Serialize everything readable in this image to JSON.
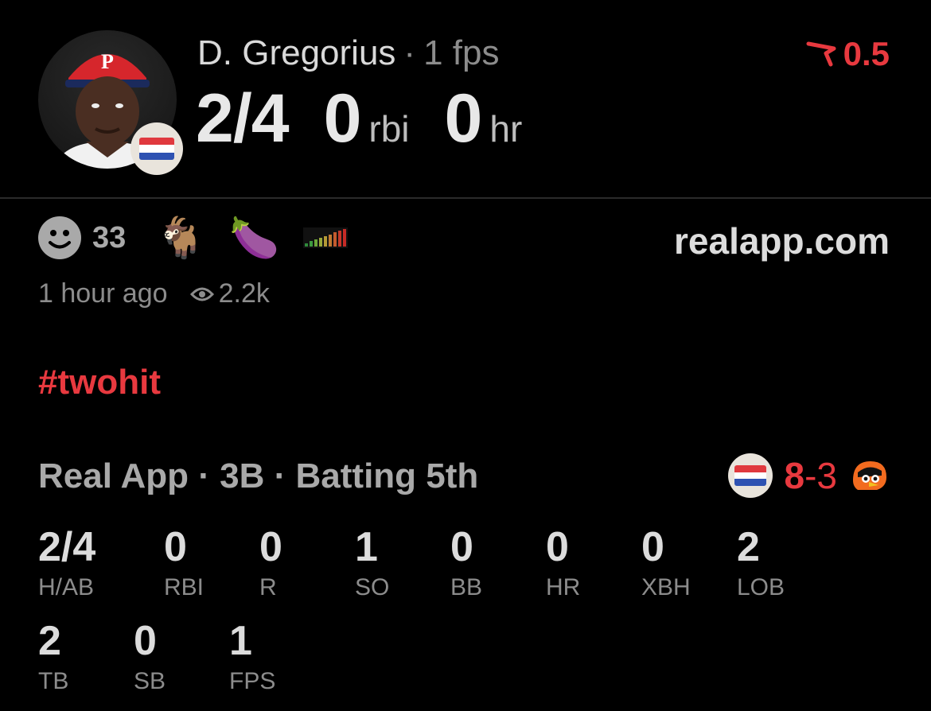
{
  "player": {
    "name": "D. Gregorius",
    "separator": "·",
    "fps": "1 fps",
    "hits_ab": "2/4",
    "rbi_value": "0",
    "rbi_unit": "rbi",
    "hr_value": "0",
    "hr_unit": "hr",
    "avatar_icon": "player-photo",
    "flag_icon": "netherlands-flag"
  },
  "rating": {
    "icon": "real-logo-icon",
    "value": "0.5",
    "color": "#e8393f"
  },
  "reactions": {
    "count": "33",
    "icons": [
      "smiley-icon",
      "goat-icon",
      "eggplant-icon",
      "meter-icon"
    ]
  },
  "site": "realapp.com",
  "meta": {
    "time": "1 hour ago",
    "views": "2.2k"
  },
  "hashtag": "#twohit",
  "game": {
    "line": "Real App · 3B · Batting 5th",
    "score_home": "8",
    "score_sep": "-",
    "score_away": "3",
    "away_icon": "orioles-logo"
  },
  "stats": [
    {
      "value": "2/4",
      "label": "H/AB"
    },
    {
      "value": "0",
      "label": "RBI"
    },
    {
      "value": "0",
      "label": "R"
    },
    {
      "value": "1",
      "label": "SO"
    },
    {
      "value": "0",
      "label": "BB"
    },
    {
      "value": "0",
      "label": "HR"
    },
    {
      "value": "0",
      "label": "XBH"
    },
    {
      "value": "2",
      "label": "LOB"
    },
    {
      "value": "2",
      "label": "TB"
    },
    {
      "value": "0",
      "label": "SB"
    },
    {
      "value": "1",
      "label": "FPS"
    }
  ]
}
